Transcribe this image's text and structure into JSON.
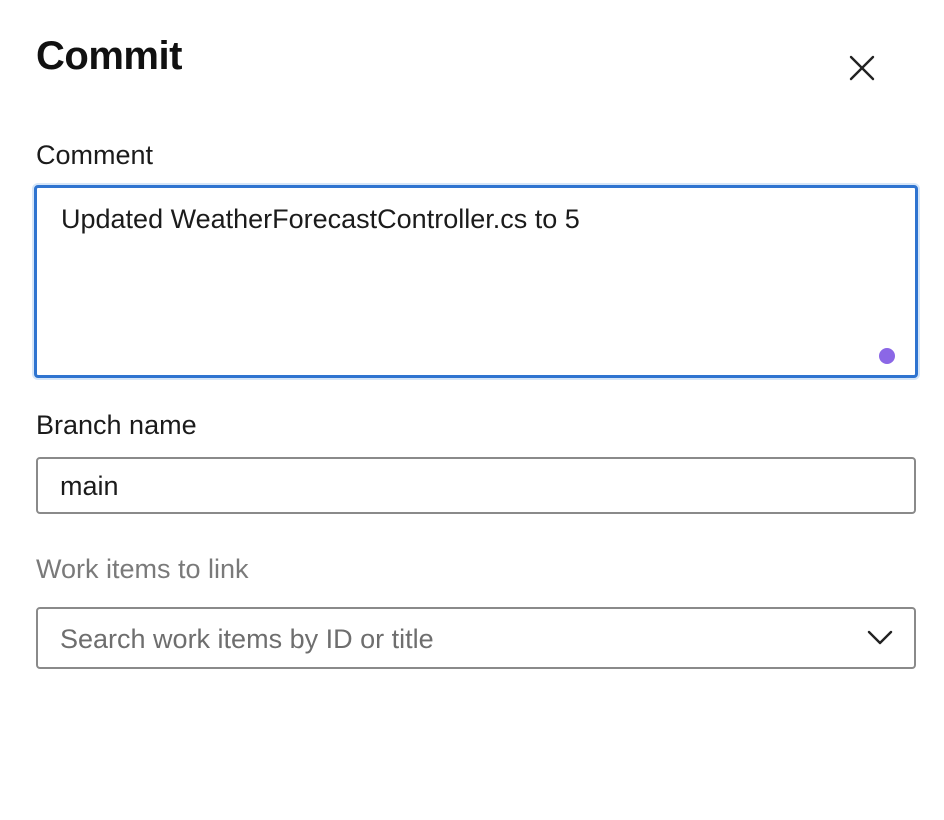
{
  "dialog": {
    "title": "Commit",
    "close_icon": "close-icon"
  },
  "comment": {
    "label": "Comment",
    "value": "Updated WeatherForecastController.cs to 5",
    "grammar_indicator_color": "#8b67e6"
  },
  "branch": {
    "label": "Branch name",
    "value": "main"
  },
  "work_items": {
    "label": "Work items to link",
    "placeholder": "Search work items by ID or title",
    "dropdown_icon": "chevron-down-icon"
  },
  "colors": {
    "focus_border": "#2f74d0",
    "input_border": "#8a8a8a",
    "muted_text": "#7a7a7a"
  }
}
